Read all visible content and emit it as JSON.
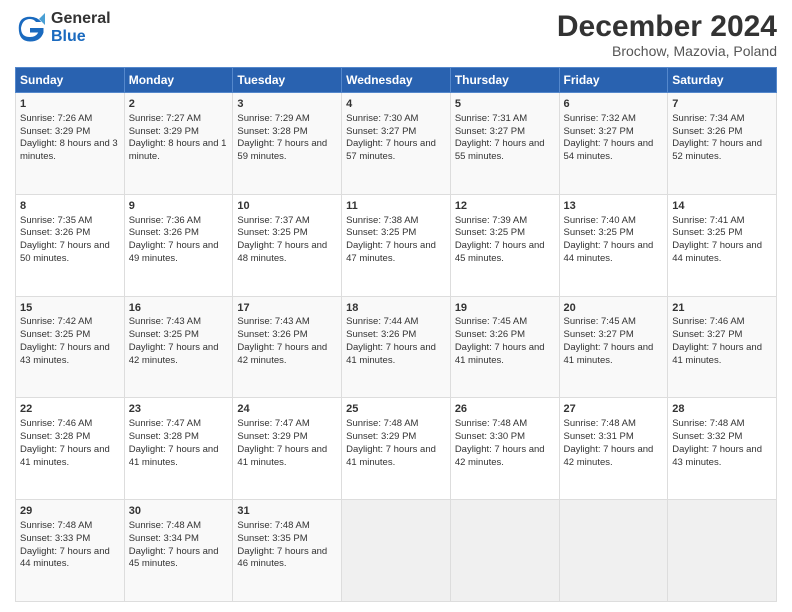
{
  "header": {
    "logo_line1": "General",
    "logo_line2": "Blue",
    "main_title": "December 2024",
    "subtitle": "Brochow, Mazovia, Poland"
  },
  "days_of_week": [
    "Sunday",
    "Monday",
    "Tuesday",
    "Wednesday",
    "Thursday",
    "Friday",
    "Saturday"
  ],
  "weeks": [
    [
      {
        "day": "1",
        "sunrise": "Sunrise: 7:26 AM",
        "sunset": "Sunset: 3:29 PM",
        "daylight": "Daylight: 8 hours and 3 minutes."
      },
      {
        "day": "2",
        "sunrise": "Sunrise: 7:27 AM",
        "sunset": "Sunset: 3:29 PM",
        "daylight": "Daylight: 8 hours and 1 minute."
      },
      {
        "day": "3",
        "sunrise": "Sunrise: 7:29 AM",
        "sunset": "Sunset: 3:28 PM",
        "daylight": "Daylight: 7 hours and 59 minutes."
      },
      {
        "day": "4",
        "sunrise": "Sunrise: 7:30 AM",
        "sunset": "Sunset: 3:27 PM",
        "daylight": "Daylight: 7 hours and 57 minutes."
      },
      {
        "day": "5",
        "sunrise": "Sunrise: 7:31 AM",
        "sunset": "Sunset: 3:27 PM",
        "daylight": "Daylight: 7 hours and 55 minutes."
      },
      {
        "day": "6",
        "sunrise": "Sunrise: 7:32 AM",
        "sunset": "Sunset: 3:27 PM",
        "daylight": "Daylight: 7 hours and 54 minutes."
      },
      {
        "day": "7",
        "sunrise": "Sunrise: 7:34 AM",
        "sunset": "Sunset: 3:26 PM",
        "daylight": "Daylight: 7 hours and 52 minutes."
      }
    ],
    [
      {
        "day": "8",
        "sunrise": "Sunrise: 7:35 AM",
        "sunset": "Sunset: 3:26 PM",
        "daylight": "Daylight: 7 hours and 50 minutes."
      },
      {
        "day": "9",
        "sunrise": "Sunrise: 7:36 AM",
        "sunset": "Sunset: 3:26 PM",
        "daylight": "Daylight: 7 hours and 49 minutes."
      },
      {
        "day": "10",
        "sunrise": "Sunrise: 7:37 AM",
        "sunset": "Sunset: 3:25 PM",
        "daylight": "Daylight: 7 hours and 48 minutes."
      },
      {
        "day": "11",
        "sunrise": "Sunrise: 7:38 AM",
        "sunset": "Sunset: 3:25 PM",
        "daylight": "Daylight: 7 hours and 47 minutes."
      },
      {
        "day": "12",
        "sunrise": "Sunrise: 7:39 AM",
        "sunset": "Sunset: 3:25 PM",
        "daylight": "Daylight: 7 hours and 45 minutes."
      },
      {
        "day": "13",
        "sunrise": "Sunrise: 7:40 AM",
        "sunset": "Sunset: 3:25 PM",
        "daylight": "Daylight: 7 hours and 44 minutes."
      },
      {
        "day": "14",
        "sunrise": "Sunrise: 7:41 AM",
        "sunset": "Sunset: 3:25 PM",
        "daylight": "Daylight: 7 hours and 44 minutes."
      }
    ],
    [
      {
        "day": "15",
        "sunrise": "Sunrise: 7:42 AM",
        "sunset": "Sunset: 3:25 PM",
        "daylight": "Daylight: 7 hours and 43 minutes."
      },
      {
        "day": "16",
        "sunrise": "Sunrise: 7:43 AM",
        "sunset": "Sunset: 3:25 PM",
        "daylight": "Daylight: 7 hours and 42 minutes."
      },
      {
        "day": "17",
        "sunrise": "Sunrise: 7:43 AM",
        "sunset": "Sunset: 3:26 PM",
        "daylight": "Daylight: 7 hours and 42 minutes."
      },
      {
        "day": "18",
        "sunrise": "Sunrise: 7:44 AM",
        "sunset": "Sunset: 3:26 PM",
        "daylight": "Daylight: 7 hours and 41 minutes."
      },
      {
        "day": "19",
        "sunrise": "Sunrise: 7:45 AM",
        "sunset": "Sunset: 3:26 PM",
        "daylight": "Daylight: 7 hours and 41 minutes."
      },
      {
        "day": "20",
        "sunrise": "Sunrise: 7:45 AM",
        "sunset": "Sunset: 3:27 PM",
        "daylight": "Daylight: 7 hours and 41 minutes."
      },
      {
        "day": "21",
        "sunrise": "Sunrise: 7:46 AM",
        "sunset": "Sunset: 3:27 PM",
        "daylight": "Daylight: 7 hours and 41 minutes."
      }
    ],
    [
      {
        "day": "22",
        "sunrise": "Sunrise: 7:46 AM",
        "sunset": "Sunset: 3:28 PM",
        "daylight": "Daylight: 7 hours and 41 minutes."
      },
      {
        "day": "23",
        "sunrise": "Sunrise: 7:47 AM",
        "sunset": "Sunset: 3:28 PM",
        "daylight": "Daylight: 7 hours and 41 minutes."
      },
      {
        "day": "24",
        "sunrise": "Sunrise: 7:47 AM",
        "sunset": "Sunset: 3:29 PM",
        "daylight": "Daylight: 7 hours and 41 minutes."
      },
      {
        "day": "25",
        "sunrise": "Sunrise: 7:48 AM",
        "sunset": "Sunset: 3:29 PM",
        "daylight": "Daylight: 7 hours and 41 minutes."
      },
      {
        "day": "26",
        "sunrise": "Sunrise: 7:48 AM",
        "sunset": "Sunset: 3:30 PM",
        "daylight": "Daylight: 7 hours and 42 minutes."
      },
      {
        "day": "27",
        "sunrise": "Sunrise: 7:48 AM",
        "sunset": "Sunset: 3:31 PM",
        "daylight": "Daylight: 7 hours and 42 minutes."
      },
      {
        "day": "28",
        "sunrise": "Sunrise: 7:48 AM",
        "sunset": "Sunset: 3:32 PM",
        "daylight": "Daylight: 7 hours and 43 minutes."
      }
    ],
    [
      {
        "day": "29",
        "sunrise": "Sunrise: 7:48 AM",
        "sunset": "Sunset: 3:33 PM",
        "daylight": "Daylight: 7 hours and 44 minutes."
      },
      {
        "day": "30",
        "sunrise": "Sunrise: 7:48 AM",
        "sunset": "Sunset: 3:34 PM",
        "daylight": "Daylight: 7 hours and 45 minutes."
      },
      {
        "day": "31",
        "sunrise": "Sunrise: 7:48 AM",
        "sunset": "Sunset: 3:35 PM",
        "daylight": "Daylight: 7 hours and 46 minutes."
      },
      null,
      null,
      null,
      null
    ]
  ]
}
